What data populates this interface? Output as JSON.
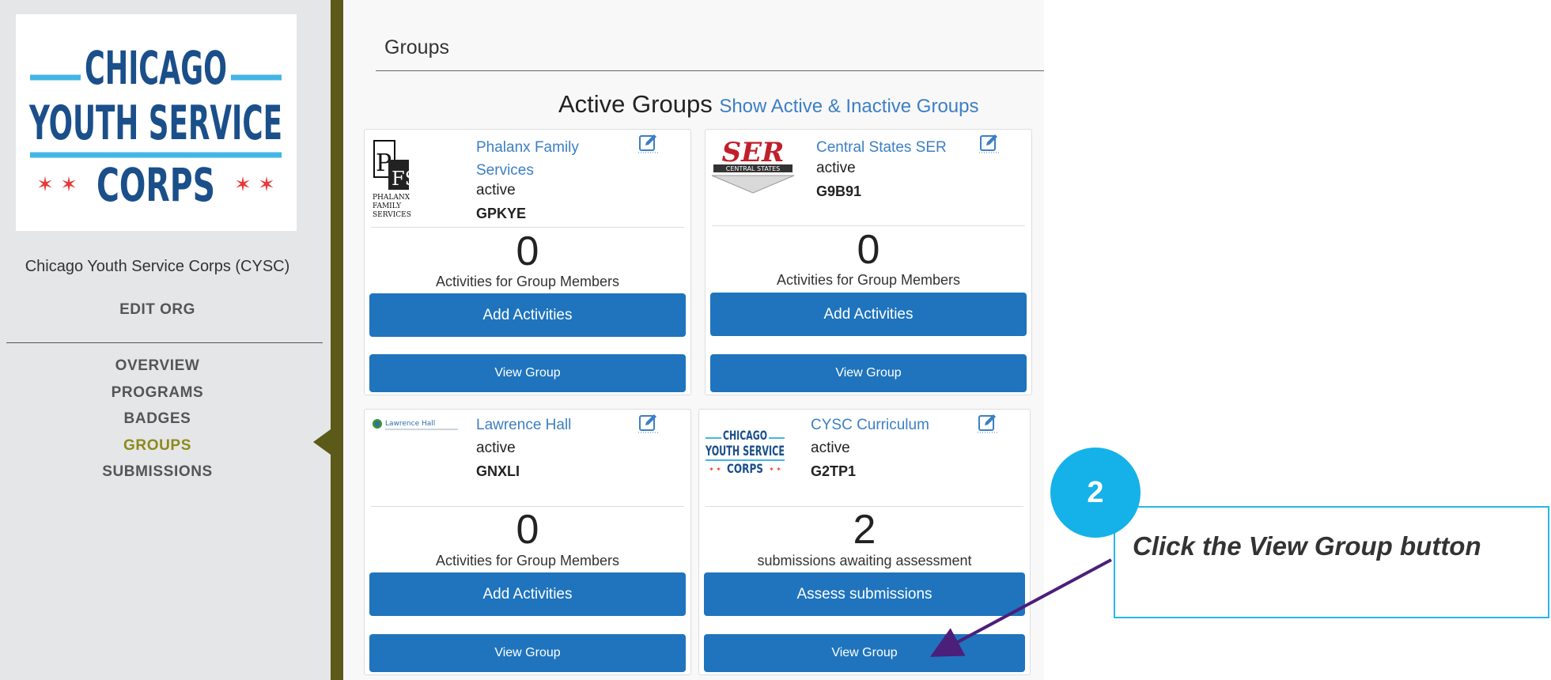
{
  "sidebar": {
    "logo_lines": [
      "CHICAGO",
      "YOUTH SERVICE",
      "CORPS"
    ],
    "org_name": "Chicago Youth Service Corps (CYSC)",
    "edit_org": "EDIT ORG",
    "nav": [
      "OVERVIEW",
      "PROGRAMS",
      "BADGES",
      "GROUPS",
      "SUBMISSIONS"
    ],
    "active_nav": "GROUPS"
  },
  "main": {
    "page_title": "Groups",
    "section_heading": "Active Groups",
    "show_all_link": "Show Active & Inactive Groups"
  },
  "groups": [
    {
      "logo": "PFS",
      "logo_subtext": [
        "PHALANX",
        "FAMILY",
        "SERVICES"
      ],
      "name": "Phalanx Family Services",
      "status": "active",
      "code": "GPKYE",
      "count": "0",
      "count_label": "Activities for Group Members",
      "action_label": "Add Activities",
      "view_label": "View Group"
    },
    {
      "logo": "SER",
      "logo_subtext": [
        "CENTRAL STATES"
      ],
      "name": "Central States SER",
      "status": "active",
      "code": "G9B91",
      "count": "0",
      "count_label": "Activities for Group Members",
      "action_label": "Add Activities",
      "view_label": "View Group"
    },
    {
      "logo": "Lawrence Hall",
      "name": "Lawrence Hall",
      "status": "active",
      "code": "GNXLI",
      "count": "0",
      "count_label": "Activities for Group Members",
      "action_label": "Add Activities",
      "view_label": "View Group"
    },
    {
      "logo_lines": [
        "CHICAGO",
        "YOUTH SERVICE",
        "CORPS"
      ],
      "name": "CYSC Curriculum",
      "status": "active",
      "code": "G2TP1",
      "count": "2",
      "count_label": "submissions awaiting assessment",
      "action_label": "Assess submissions",
      "view_label": "View Group"
    }
  ],
  "callout": {
    "step": "2",
    "text": "Click the View Group button"
  },
  "colors": {
    "accent_blue": "#1f74bd",
    "link_blue": "#3c7fc4",
    "sidebar_stripe": "#5b5a18",
    "active_nav": "#8c8a1a",
    "callout_cyan": "#14b2e8",
    "arrow_purple": "#4b1f7a"
  }
}
